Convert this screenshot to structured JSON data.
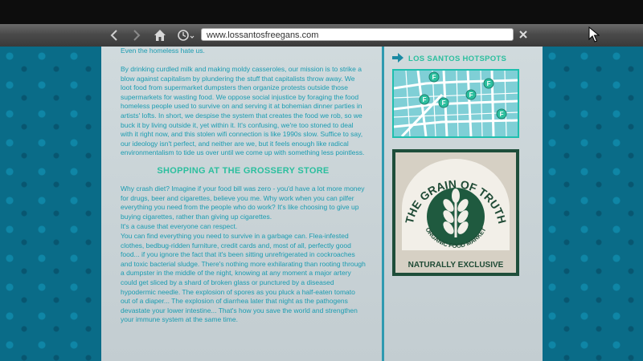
{
  "browser": {
    "url": "www.lossantosfreegans.com",
    "icons": [
      "back-arrow",
      "forward-arrow",
      "home",
      "history",
      "close"
    ]
  },
  "article": {
    "intro_tail": "Even the homeless hate us.",
    "paragraph1": "By drinking curdled milk and making moldy casseroles, our mission is to strike a blow against capitalism by plundering the stuff that capitalists throw away. We loot food from supermarket dumpsters then organize protests outside those supermarkets for wasting food. We oppose social injustice by foraging the food homeless people used to survive on and serving it at bohemian dinner parties in artists' lofts. In short, we despise the system that creates the food we rob, so we buck it by living outside it, yet within it. It's confusing, we're too stoned to deal with it right now, and this stolen wifi connection is like 1990s slow. Suffice to say, our ideology isn't perfect, and neither are we, but it feels enough like radical environmentalism to tide us over until we come up with something less pointless.",
    "heading": "SHOPPING AT THE GROSSERY STORE",
    "paragraph2": "Why crash diet? Imagine if your food bill was zero - you'd have a lot more money for drugs, beer and cigarettes, believe you me. Why work when you can pilfer everything you need from the people who do work? It's like choosing to give up buying cigarettes, rather than giving up cigarettes.",
    "paragraph3": "It's a cause that everyone can respect.",
    "paragraph4": "You can find everything you need to survive in a garbage can. Flea-infested clothes, bedbug-ridden furniture, credit cards and, most of all, perfectly good food... if you ignore the fact that it's been sitting unrefrigerated in cockroaches and toxic bacterial sludge. There's nothing more exhilarating than rooting through a dumpster in the middle of the night, knowing at any moment a major artery could get sliced by a shard of broken glass or punctured by a diseased hypodermic needle. The explosion of spores as you pluck a half-eaten tomato out of a diaper... The explosion of diarrhea later that night as the pathogens devastate your lower intestine... That's how you save the world and strengthen your immune system at the same time."
  },
  "sidebar": {
    "hotspots_heading": "LOS SANTOS HOTSPOTS",
    "map_pin_label": "F",
    "ad": {
      "arc_text": "THE GRAIN OF TRUTH",
      "sub_text": "ORGANIC FOOD MARKET",
      "tagline": "NATURALLY EXCLUSIVE"
    }
  },
  "colors": {
    "accent_heading": "#2bbf9e",
    "body_text": "#1a9cb1",
    "page_bg": "#c9d3d6",
    "pattern_bg": "#0a6c88",
    "ad_green": "#1e4e3a"
  }
}
